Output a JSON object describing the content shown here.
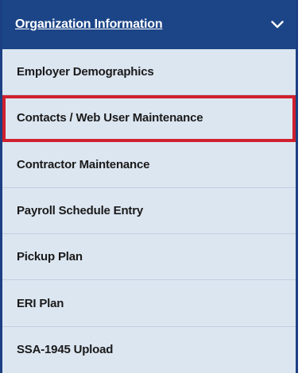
{
  "menu": {
    "title": "Organization Information",
    "expanded": true,
    "header_color": "#1c4587",
    "background_color": "#dce6f1",
    "highlight_color": "#d0202e",
    "items": [
      {
        "label": "Employer Demographics",
        "highlighted": false
      },
      {
        "label": "Contacts / Web User Maintenance",
        "highlighted": true
      },
      {
        "label": "Contractor Maintenance",
        "highlighted": false
      },
      {
        "label": "Payroll Schedule Entry",
        "highlighted": false
      },
      {
        "label": "Pickup Plan",
        "highlighted": false
      },
      {
        "label": "ERI Plan",
        "highlighted": false
      },
      {
        "label": "SSA-1945 Upload",
        "highlighted": false
      }
    ]
  }
}
